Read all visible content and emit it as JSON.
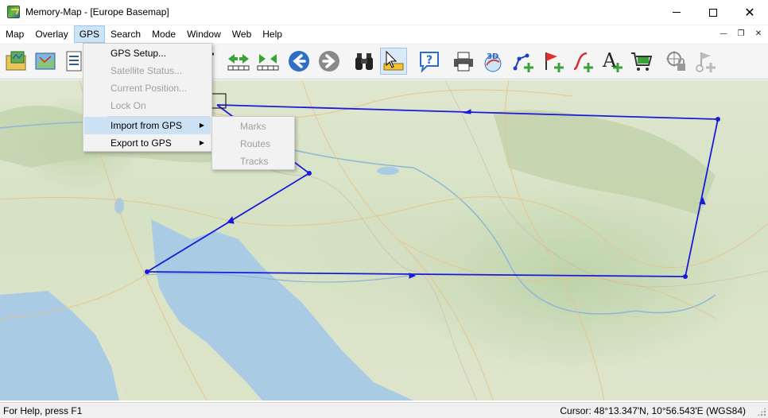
{
  "window": {
    "title": "Memory-Map - [Europe Basemap]",
    "minimize_label": "minimize",
    "maximize_label": "maximize",
    "close_label": "close"
  },
  "menubar": {
    "items": [
      "Map",
      "Overlay",
      "GPS",
      "Search",
      "Mode",
      "Window",
      "Web",
      "Help"
    ],
    "active": "GPS"
  },
  "gps_menu": {
    "items": [
      {
        "label": "GPS Setup...",
        "enabled": true
      },
      {
        "label": "Satellite Status...",
        "enabled": false
      },
      {
        "label": "Current Position...",
        "enabled": false
      },
      {
        "label": "Lock On",
        "enabled": false
      },
      {
        "label": "Import from GPS",
        "enabled": true,
        "submenu": true,
        "highlighted": true
      },
      {
        "label": "Export to GPS",
        "enabled": true,
        "submenu": true
      }
    ]
  },
  "import_submenu": {
    "items": [
      {
        "label": "Marks",
        "enabled": false
      },
      {
        "label": "Routes",
        "enabled": false
      },
      {
        "label": "Tracks",
        "enabled": false
      }
    ]
  },
  "toolbar": {
    "icons": [
      "open-map-icon",
      "overlay-map-icon",
      "list-icon",
      "zoom-in-icon",
      "pan-left-icon",
      "pan-right-icon",
      "back-icon",
      "forward-icon",
      "find-icon",
      "select-mode-icon",
      "help-icon",
      "print-icon",
      "3d-view-icon",
      "add-route-icon",
      "add-mark-icon",
      "add-track-icon",
      "add-text-icon",
      "shop-icon",
      "lock-icon",
      "delete-mark-icon"
    ]
  },
  "statusbar": {
    "help_text": "For Help, press F1",
    "cursor_text": "Cursor: 48°13.347'N, 10°56.543'E (WGS84)"
  },
  "colors": {
    "route": "#1a1adc",
    "menu_highlight": "#cde1f5",
    "menubar_active": "#cce4f7"
  }
}
